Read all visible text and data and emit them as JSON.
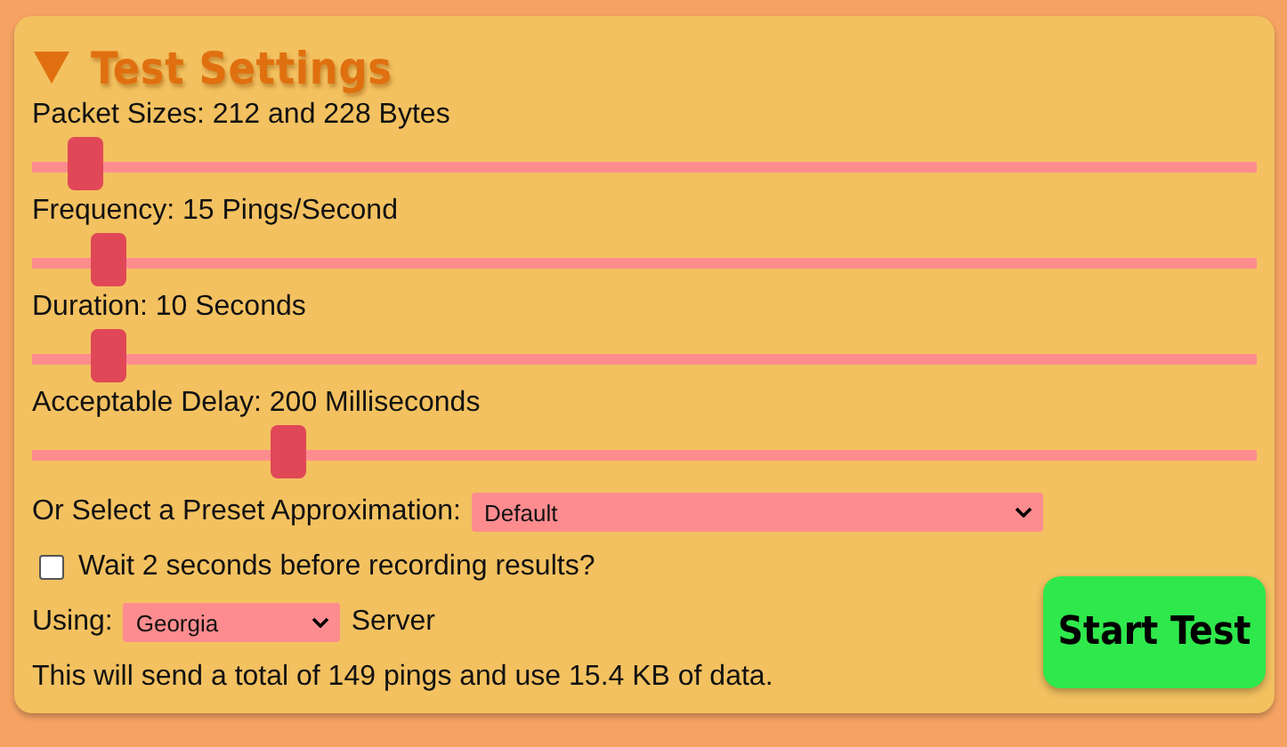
{
  "section": {
    "title": "Test Settings",
    "expanded": true
  },
  "sliders": [
    {
      "label": "Packet Sizes: 212 and 228 Bytes",
      "level": 0.03
    },
    {
      "label": "Frequency: 15 Pings/Second",
      "level": 0.05
    },
    {
      "label": "Duration: 10 Seconds",
      "level": 0.05
    },
    {
      "label": "Acceptable Delay: 200 Milliseconds",
      "level": 0.2
    }
  ],
  "preset": {
    "label": "Or Select a Preset Approximation:",
    "value": "Default"
  },
  "wait_option": {
    "label": "Wait 2 seconds before recording results?",
    "checked": false
  },
  "server": {
    "prefix": "Using:",
    "value": "Georgia",
    "suffix": "Server"
  },
  "summary": "This will send a total of 149 pings and use 15.4 KB of data.",
  "start_button": "Start Test"
}
